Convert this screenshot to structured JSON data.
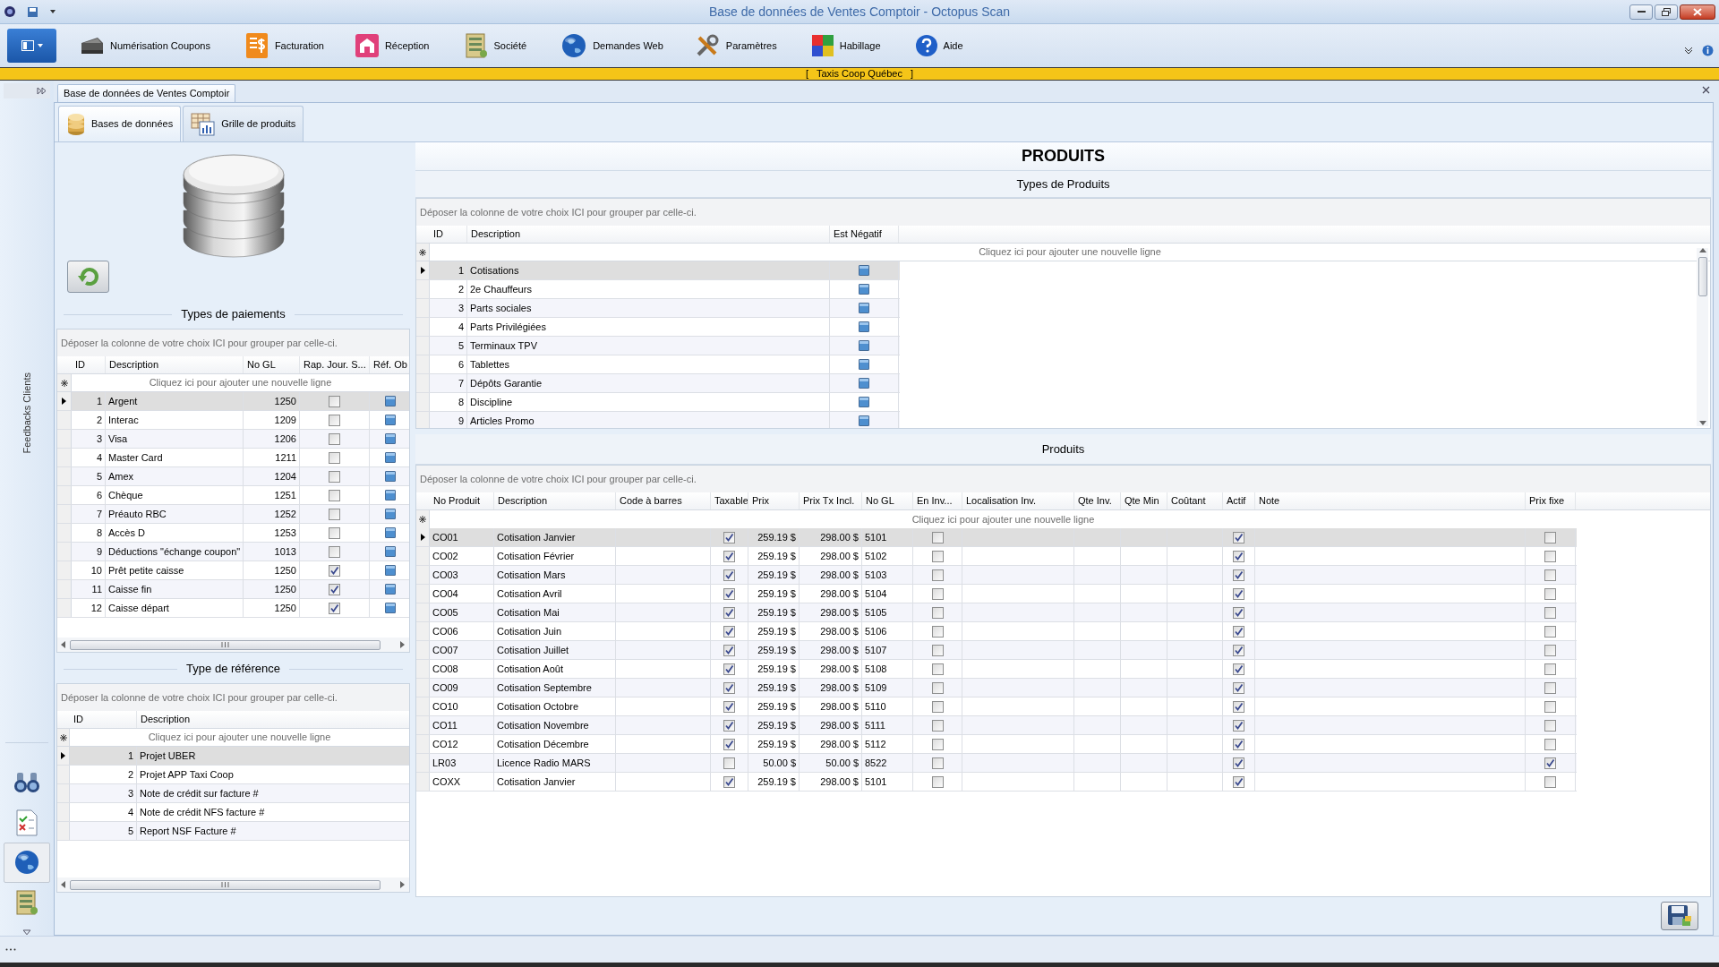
{
  "window": {
    "title": "Base de données de Ventes Comptoir - Octopus Scan"
  },
  "ribbon": {
    "items": [
      {
        "label": "Numérisation Coupons",
        "kind": "scanner"
      },
      {
        "label": "Facturation",
        "kind": "invoice"
      },
      {
        "label": "Réception",
        "kind": "reception"
      },
      {
        "label": "Société",
        "kind": "company"
      },
      {
        "label": "Demandes Web",
        "kind": "web"
      },
      {
        "label": "Paramètres",
        "kind": "tools"
      },
      {
        "label": "Habillage",
        "kind": "palette"
      },
      {
        "label": "Aide",
        "kind": "help"
      }
    ]
  },
  "banner": "[   Taxis Coop Québec   ]",
  "document_tab": {
    "label": "Base de données de Ventes Comptoir"
  },
  "sidebar": {
    "label": "Feedbacks Clients",
    "icons": [
      {
        "kind": "binoculars",
        "selected": false
      },
      {
        "kind": "checklist",
        "selected": false
      },
      {
        "kind": "globe",
        "selected": true
      },
      {
        "kind": "ledger",
        "selected": false
      }
    ]
  },
  "tabs": [
    {
      "label": "Bases de données",
      "kind": "database",
      "selected": true
    },
    {
      "label": "Grille de produits",
      "kind": "grid",
      "selected": false
    }
  ],
  "payment_types": {
    "title": "Types de paiements",
    "group_hint": "Déposer la colonne de votre choix ICI pour grouper par celle-ci.",
    "columns": [
      "ID",
      "Description",
      "No GL",
      "Rap. Jour. S...",
      "Réf. Ob"
    ],
    "new_row": "Cliquez ici pour ajouter une nouvelle ligne",
    "rows": [
      {
        "id": "1",
        "description": "Argent",
        "gl": "1250",
        "daily_report": false,
        "selected": true
      },
      {
        "id": "2",
        "description": "Interac",
        "gl": "1209",
        "daily_report": false,
        "selected": false
      },
      {
        "id": "3",
        "description": "Visa",
        "gl": "1206",
        "daily_report": false,
        "selected": false
      },
      {
        "id": "4",
        "description": "Master Card",
        "gl": "1211",
        "daily_report": false,
        "selected": false
      },
      {
        "id": "5",
        "description": "Amex",
        "gl": "1204",
        "daily_report": false,
        "selected": false
      },
      {
        "id": "6",
        "description": "Chèque",
        "gl": "1251",
        "daily_report": false,
        "selected": false
      },
      {
        "id": "7",
        "description": "Préauto RBC",
        "gl": "1252",
        "daily_report": false,
        "selected": false
      },
      {
        "id": "8",
        "description": "Accès D",
        "gl": "1253",
        "daily_report": false,
        "selected": false
      },
      {
        "id": "9",
        "description": "Déductions \"échange coupon\"",
        "gl": "1013",
        "daily_report": false,
        "selected": false
      },
      {
        "id": "10",
        "description": "Prêt petite caisse",
        "gl": "1250",
        "daily_report": true,
        "selected": false
      },
      {
        "id": "11",
        "description": "Caisse fin",
        "gl": "1250",
        "daily_report": true,
        "selected": false
      },
      {
        "id": "12",
        "description": "Caisse départ",
        "gl": "1250",
        "daily_report": true,
        "selected": false
      }
    ]
  },
  "reference_types": {
    "title": "Type de référence",
    "group_hint": "Déposer la colonne de votre choix ICI pour grouper par celle-ci.",
    "columns": [
      "ID",
      "Description"
    ],
    "new_row": "Cliquez ici pour ajouter une nouvelle ligne",
    "rows": [
      {
        "id": "1",
        "description": "Projet UBER",
        "selected": true
      },
      {
        "id": "2",
        "description": "Projet APP Taxi Coop",
        "selected": false
      },
      {
        "id": "3",
        "description": "Note de crédit sur facture #",
        "selected": false
      },
      {
        "id": "4",
        "description": "Note de crédit NFS facture #",
        "selected": false
      },
      {
        "id": "5",
        "description": "Report NSF Facture #",
        "selected": false
      }
    ]
  },
  "heading": "PRODUITS",
  "product_types": {
    "title": "Types de Produits",
    "group_hint": "Déposer la colonne de votre choix ICI pour grouper par celle-ci.",
    "columns": [
      "ID",
      "Description",
      "Est Négatif"
    ],
    "new_row": "Cliquez ici pour ajouter une nouvelle ligne",
    "rows": [
      {
        "id": "1",
        "description": "Cotisations",
        "selected": true
      },
      {
        "id": "2",
        "description": "2e Chauffeurs",
        "selected": false
      },
      {
        "id": "3",
        "description": "Parts sociales",
        "selected": false
      },
      {
        "id": "4",
        "description": "Parts Privilégiées",
        "selected": false
      },
      {
        "id": "5",
        "description": "Terminaux TPV",
        "selected": false
      },
      {
        "id": "6",
        "description": "Tablettes",
        "selected": false
      },
      {
        "id": "7",
        "description": "Dépôts Garantie",
        "selected": false
      },
      {
        "id": "8",
        "description": "Discipline",
        "selected": false
      },
      {
        "id": "9",
        "description": "Articles Promo",
        "selected": false
      }
    ]
  },
  "products": {
    "title": "Produits",
    "group_hint": "Déposer la colonne de votre choix ICI pour grouper par celle-ci.",
    "columns": [
      "No Produit",
      "Description",
      "Code à barres",
      "Taxable",
      "Prix",
      "Prix Tx Incl.",
      "No GL",
      "En Inv...",
      "Localisation Inv.",
      "Qte Inv.",
      "Qte Min",
      "Coûtant",
      "Actif",
      "Note",
      "Prix fixe"
    ],
    "new_row": "Cliquez ici pour ajouter une nouvelle ligne",
    "rows": [
      {
        "code": "CO01",
        "description": "Cotisation Janvier",
        "taxable": true,
        "price": "259.19 $",
        "price_incl": "298.00 $",
        "gl": "5101",
        "in_inventory": false,
        "active": true,
        "fixed_price": false,
        "selected": true
      },
      {
        "code": "CO02",
        "description": "Cotisation Février",
        "taxable": true,
        "price": "259.19 $",
        "price_incl": "298.00 $",
        "gl": "5102",
        "in_inventory": false,
        "active": true,
        "fixed_price": false,
        "selected": false
      },
      {
        "code": "CO03",
        "description": "Cotisation Mars",
        "taxable": true,
        "price": "259.19 $",
        "price_incl": "298.00 $",
        "gl": "5103",
        "in_inventory": false,
        "active": true,
        "fixed_price": false,
        "selected": false
      },
      {
        "code": "CO04",
        "description": "Cotisation Avril",
        "taxable": true,
        "price": "259.19 $",
        "price_incl": "298.00 $",
        "gl": "5104",
        "in_inventory": false,
        "active": true,
        "fixed_price": false,
        "selected": false
      },
      {
        "code": "CO05",
        "description": "Cotisation Mai",
        "taxable": true,
        "price": "259.19 $",
        "price_incl": "298.00 $",
        "gl": "5105",
        "in_inventory": false,
        "active": true,
        "fixed_price": false,
        "selected": false
      },
      {
        "code": "CO06",
        "description": "Cotisation Juin",
        "taxable": true,
        "price": "259.19 $",
        "price_incl": "298.00 $",
        "gl": "5106",
        "in_inventory": false,
        "active": true,
        "fixed_price": false,
        "selected": false
      },
      {
        "code": "CO07",
        "description": "Cotisation Juillet",
        "taxable": true,
        "price": "259.19 $",
        "price_incl": "298.00 $",
        "gl": "5107",
        "in_inventory": false,
        "active": true,
        "fixed_price": false,
        "selected": false
      },
      {
        "code": "CO08",
        "description": "Cotisation Août",
        "taxable": true,
        "price": "259.19 $",
        "price_incl": "298.00 $",
        "gl": "5108",
        "in_inventory": false,
        "active": true,
        "fixed_price": false,
        "selected": false
      },
      {
        "code": "CO09",
        "description": "Cotisation Septembre",
        "taxable": true,
        "price": "259.19 $",
        "price_incl": "298.00 $",
        "gl": "5109",
        "in_inventory": false,
        "active": true,
        "fixed_price": false,
        "selected": false
      },
      {
        "code": "CO10",
        "description": "Cotisation Octobre",
        "taxable": true,
        "price": "259.19 $",
        "price_incl": "298.00 $",
        "gl": "5110",
        "in_inventory": false,
        "active": true,
        "fixed_price": false,
        "selected": false
      },
      {
        "code": "CO11",
        "description": "Cotisation Novembre",
        "taxable": true,
        "price": "259.19 $",
        "price_incl": "298.00 $",
        "gl": "5111",
        "in_inventory": false,
        "active": true,
        "fixed_price": false,
        "selected": false
      },
      {
        "code": "CO12",
        "description": "Cotisation Décembre",
        "taxable": true,
        "price": "259.19 $",
        "price_incl": "298.00 $",
        "gl": "5112",
        "in_inventory": false,
        "active": true,
        "fixed_price": false,
        "selected": false
      },
      {
        "code": "LR03",
        "description": "Licence Radio MARS",
        "taxable": false,
        "price": "50.00 $",
        "price_incl": "50.00 $",
        "gl": "8522",
        "in_inventory": false,
        "active": true,
        "fixed_price": true,
        "selected": false
      },
      {
        "code": "COXX",
        "description": "Cotisation Janvier",
        "taxable": true,
        "price": "259.19 $",
        "price_incl": "298.00 $",
        "gl": "5101",
        "in_inventory": false,
        "active": true,
        "fixed_price": false,
        "selected": false
      }
    ]
  }
}
